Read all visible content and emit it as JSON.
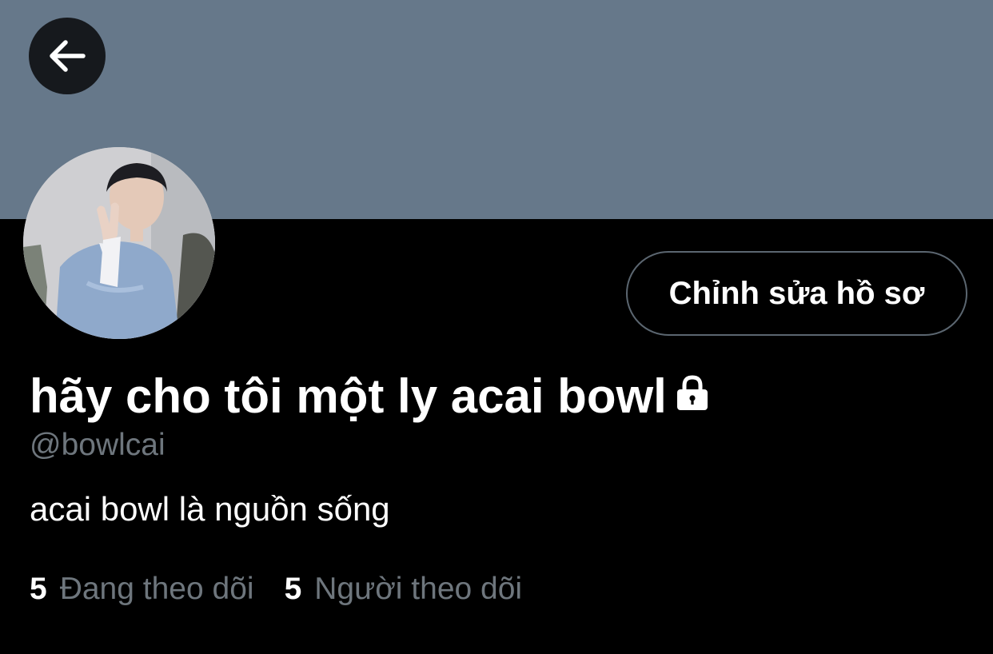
{
  "header": {
    "banner_color": "#66788a",
    "back_icon": "arrow-left-icon"
  },
  "profile": {
    "avatar_icon": "profile-photo",
    "edit_button_label": "Chỉnh sửa hồ sơ",
    "display_name": "hãy cho tôi một ly acai bowl",
    "protected_icon": "lock-icon",
    "handle": "@bowlcai",
    "bio": "acai bowl là nguồn sống"
  },
  "stats": {
    "following": {
      "count": "5",
      "label": "Đang theo dõi"
    },
    "followers": {
      "count": "5",
      "label": "Người theo dõi"
    }
  }
}
